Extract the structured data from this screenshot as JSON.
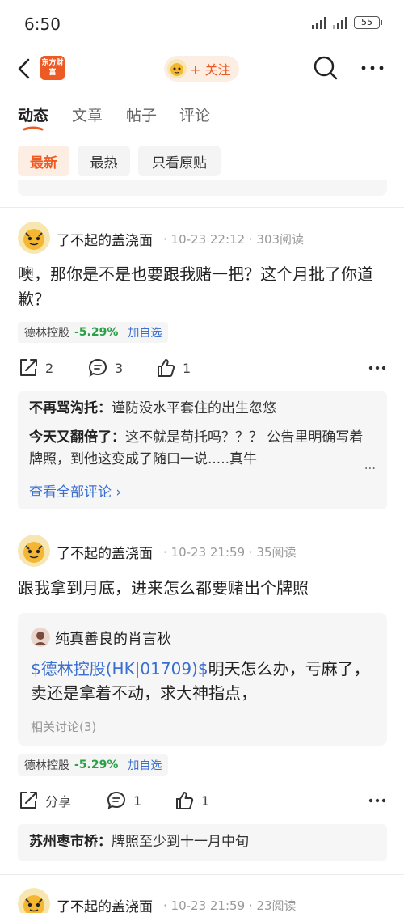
{
  "status": {
    "time": "6:50",
    "battery": "55"
  },
  "nav": {
    "brand_logo": "东方财富",
    "follow_label": "+ 关注",
    "icons": [
      "back-arrow-icon",
      "search-icon",
      "more-dots-icon"
    ]
  },
  "tabs": [
    {
      "label": "动态",
      "active": true
    },
    {
      "label": "文章",
      "active": false
    },
    {
      "label": "帖子",
      "active": false
    },
    {
      "label": "评论",
      "active": false
    }
  ],
  "filters": [
    {
      "label": "最新",
      "active": true
    },
    {
      "label": "最热",
      "active": false
    },
    {
      "label": "只看原贴",
      "active": false
    }
  ],
  "colors": {
    "accent": "#ee5a24",
    "link": "#3a6fd0",
    "down_green": "#2aa146"
  },
  "posts": [
    {
      "author": "了不起的盖浇面",
      "meta": "· 10-23 22:12 · 303阅读",
      "text": "噢，那你是不是也要跟我赌一把？这个月批了你道歉？",
      "stock": {
        "name": "德林控股",
        "pct": "-5.29%",
        "add": "加自选"
      },
      "actions": {
        "share": "2",
        "comment": "3",
        "like": "1"
      },
      "comments": [
        {
          "user": "不再骂沟托：",
          "text": "谨防没水平套住的出生忽悠"
        },
        {
          "user": "今天又翻倍了：",
          "text": "这不就是苟托吗？？？ 公告里明确写着牌照，到他这变成了随口一说.....真牛"
        }
      ],
      "comment_more": "...",
      "view_all": "查看全部评论 ›"
    },
    {
      "author": "了不起的盖浇面",
      "meta": "· 10-23 21:59 · 35阅读",
      "text": "跟我拿到月底，进来怎么都要赌出个牌照",
      "quote": {
        "author": "纯真善良的肖言秋",
        "link": "$德林控股(HK|01709)$",
        "text": "明天怎么办，亏麻了，卖还是拿着不动，求大神指点，",
        "related": "相关讨论(3)"
      },
      "stock": {
        "name": "德林控股",
        "pct": "-5.29%",
        "add": "加自选"
      },
      "actions": {
        "share": "分享",
        "comment": "1",
        "like": "1"
      },
      "comments": [
        {
          "user": "苏州枣市桥：",
          "text": "牌照至少到十一月中旬"
        }
      ]
    },
    {
      "author": "了不起的盖浇面",
      "meta": "· 10-23 21:59 · 23阅读"
    }
  ]
}
